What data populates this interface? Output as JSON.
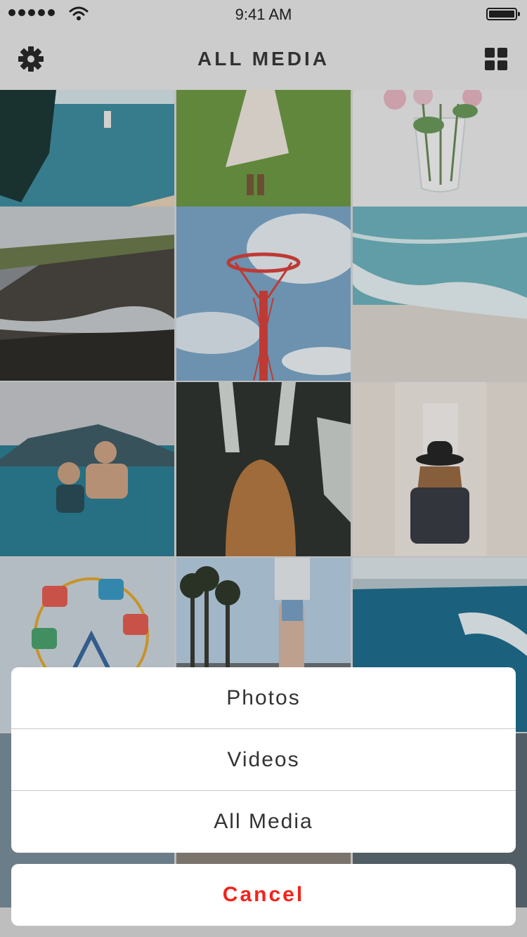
{
  "status_bar": {
    "time": "9:41 AM",
    "signal_icon": "signal-dots-icon",
    "wifi_icon": "wifi-icon",
    "battery_icon": "battery-icon"
  },
  "nav": {
    "title": "ALL MEDIA",
    "left_icon": "gear-icon",
    "right_icon": "grid-view-icon"
  },
  "grid": {
    "tiles": [
      {
        "subject": "cliff-and-sea"
      },
      {
        "subject": "woman-in-field"
      },
      {
        "subject": "flowers-in-vase"
      },
      {
        "subject": "rocky-coast"
      },
      {
        "subject": "red-tower"
      },
      {
        "subject": "beach-waves"
      },
      {
        "subject": "snorkelers"
      },
      {
        "subject": "waterfall-hair"
      },
      {
        "subject": "woman-with-hat"
      },
      {
        "subject": "ferris-wheel"
      },
      {
        "subject": "palm-beach"
      },
      {
        "subject": "surf-coast"
      }
    ]
  },
  "action_sheet": {
    "options": [
      "Photos",
      "Videos",
      "All Media"
    ],
    "cancel_label": "Cancel"
  },
  "colors": {
    "cancel_text": "#f2231c",
    "nav_background": "#e9e9e9",
    "sheet_background": "#ffffff"
  }
}
